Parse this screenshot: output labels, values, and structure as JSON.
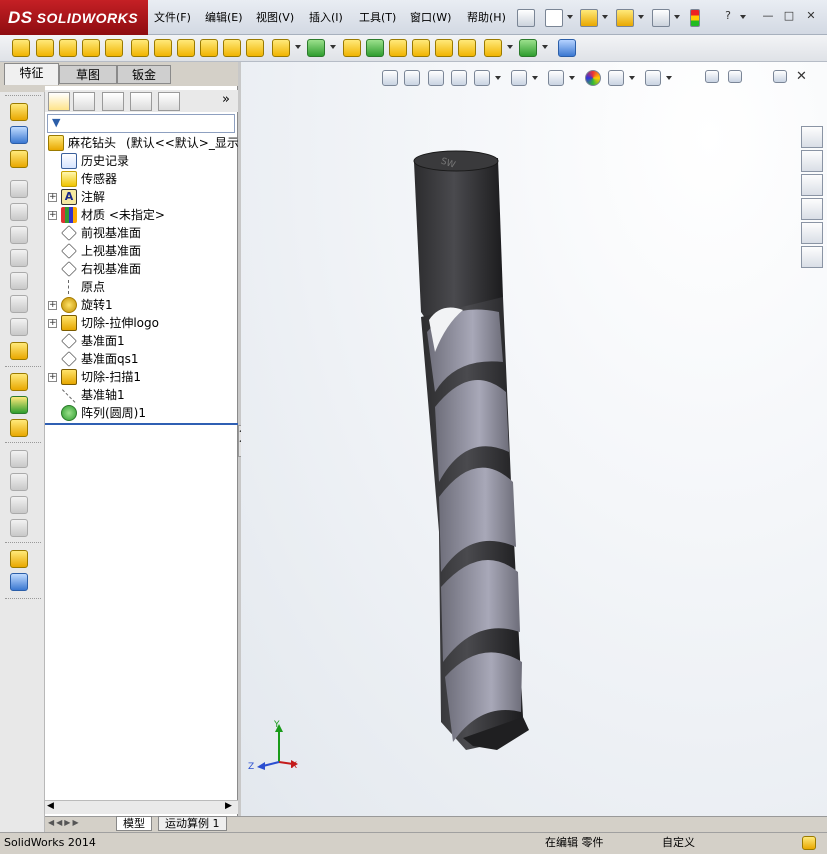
{
  "app": {
    "logo_ds": "DS",
    "logo_name": "SOLIDWORKS"
  },
  "menu": [
    {
      "label": "文件(F)"
    },
    {
      "label": "编辑(E)"
    },
    {
      "label": "视图(V)"
    },
    {
      "label": "插入(I)"
    },
    {
      "label": "工具(T)"
    },
    {
      "label": "窗口(W)"
    },
    {
      "label": "帮助(H)"
    }
  ],
  "window_buttons": {
    "help": "?",
    "minimize": "—",
    "restore": "□",
    "close": "✕"
  },
  "command_tabs": [
    {
      "label": "特征",
      "active": true
    },
    {
      "label": "草图",
      "active": false
    },
    {
      "label": "钣金",
      "active": false
    }
  ],
  "feature_tree": {
    "part_name": "麻花钻头",
    "part_config": "(默认<<默认>_显示状",
    "items": [
      {
        "label": "历史记录",
        "icon": "history-icon",
        "expandable": false
      },
      {
        "label": "传感器",
        "icon": "sensor-icon",
        "expandable": false
      },
      {
        "label": "注解",
        "icon": "annotation-icon",
        "expandable": true
      },
      {
        "label": "材质 <未指定>",
        "icon": "material-icon",
        "expandable": true
      },
      {
        "label": "前视基准面",
        "icon": "plane-icon",
        "expandable": false
      },
      {
        "label": "上视基准面",
        "icon": "plane-icon",
        "expandable": false
      },
      {
        "label": "右视基准面",
        "icon": "plane-icon",
        "expandable": false
      },
      {
        "label": "原点",
        "icon": "origin-icon",
        "expandable": false
      },
      {
        "label": "旋转1",
        "icon": "revolve-icon",
        "expandable": true
      },
      {
        "label": "切除-拉伸logo",
        "icon": "cut-extrude-icon",
        "expandable": true
      },
      {
        "label": "基准面1",
        "icon": "plane-icon",
        "expandable": false
      },
      {
        "label": "基准面qs1",
        "icon": "plane-icon",
        "expandable": false
      },
      {
        "label": "切除-扫描1",
        "icon": "cut-sweep-icon",
        "expandable": true
      },
      {
        "label": "基准轴1",
        "icon": "axis-icon",
        "expandable": false
      },
      {
        "label": "阵列(圆周)1",
        "icon": "circular-pattern-icon",
        "expandable": false
      }
    ]
  },
  "view": {
    "triad": {
      "x": "X",
      "y": "Y",
      "z": "Z"
    },
    "part_colors": {
      "body": "#2c2c2e",
      "flute": "#6e6e7a",
      "highlight": "#a8a8b8"
    },
    "logo_text": "SW"
  },
  "bottom_tabs": [
    {
      "label": "模型",
      "active": true
    },
    {
      "label": "运动算例 1",
      "active": false
    }
  ],
  "status": {
    "product": "SolidWorks 2014",
    "mode": "在编辑 零件",
    "units": "自定义"
  }
}
